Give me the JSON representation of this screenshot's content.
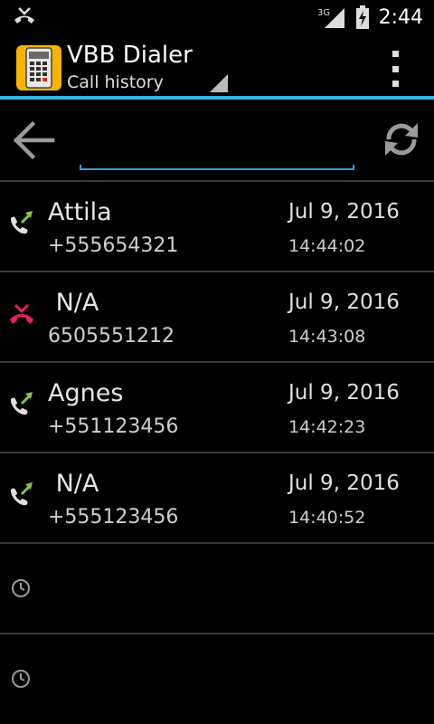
{
  "status_bar": {
    "network": "3G",
    "time": "2:44"
  },
  "header": {
    "title": "VBB Dialer",
    "subtitle": "Call history"
  },
  "search": {
    "placeholder": "",
    "value": ""
  },
  "calls": [
    {
      "name": "Attila",
      "number": "+555654321",
      "date": "Jul 9, 2016",
      "time": "14:44:02",
      "type": "outgoing"
    },
    {
      "name": " N/A",
      "number": "6505551212",
      "date": "Jul 9, 2016",
      "time": "14:43:08",
      "type": "missed"
    },
    {
      "name": "Agnes",
      "number": "+551123456",
      "date": "Jul 9, 2016",
      "time": "14:42:23",
      "type": "outgoing"
    },
    {
      "name": " N/A",
      "number": "+555123456",
      "date": "Jul 9, 2016",
      "time": "14:40:52",
      "type": "outgoing"
    }
  ],
  "colors": {
    "accent": "#33b5e5",
    "outgoing_arrow": "#8bc34a",
    "missed": "#e91e63"
  }
}
